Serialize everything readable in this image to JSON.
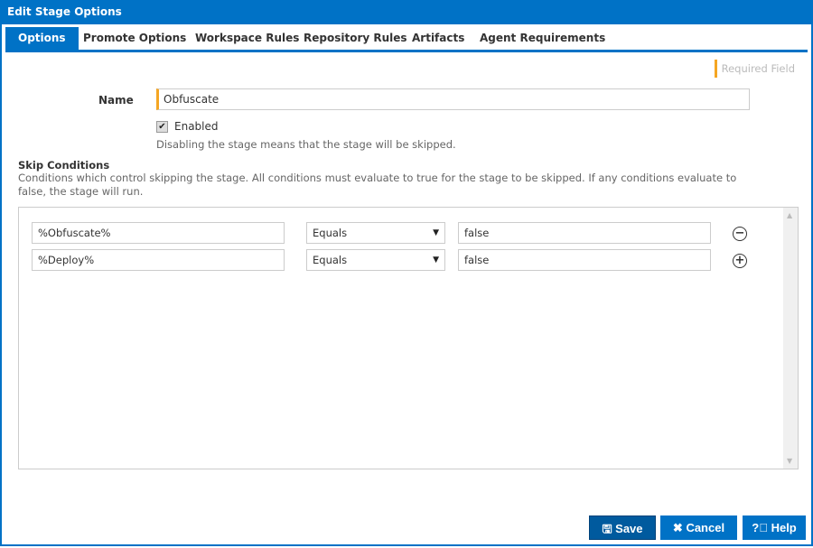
{
  "window": {
    "title": "Edit Stage Options"
  },
  "tabs": [
    {
      "label": "Options",
      "active": true
    },
    {
      "label": "Promote Options",
      "active": false
    },
    {
      "label": "Workspace Rules",
      "active": false
    },
    {
      "label": "Repository Rules",
      "active": false
    },
    {
      "label": "Artifacts",
      "active": false
    },
    {
      "label": "Agent Requirements",
      "active": false
    }
  ],
  "required_field_label": "Required Field",
  "form": {
    "name_label": "Name",
    "name_value": "Obfuscate",
    "enabled_label": "Enabled",
    "enabled_checked": true,
    "enabled_help": "Disabling the stage means that the stage will be skipped."
  },
  "skip_conditions": {
    "title": "Skip Conditions",
    "description": "Conditions which control skipping the stage. All conditions must evaluate to true for the stage to be skipped. If any conditions evaluate to false, the stage will run.",
    "rows": [
      {
        "variable": "%Obfuscate%",
        "operator": "Equals",
        "value": "false",
        "action_icon": "remove-circle-icon"
      },
      {
        "variable": "%Deploy%",
        "operator": "Equals",
        "value": "false",
        "action_icon": "add-circle-icon"
      }
    ]
  },
  "buttons": {
    "save": "Save",
    "cancel": "Cancel",
    "help": "Help"
  },
  "colors": {
    "accent": "#0072c6",
    "required": "#f5a623"
  }
}
